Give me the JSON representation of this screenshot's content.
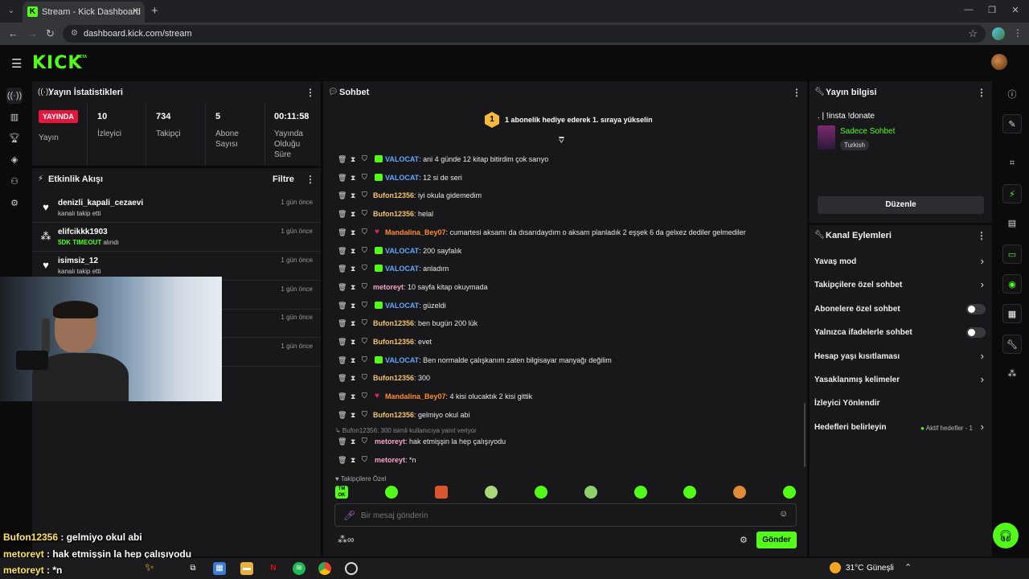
{
  "browser": {
    "tab_title": "Stream - Kick Dashboard",
    "url": "dashboard.kick.com/stream"
  },
  "header": {
    "logo": "KICK",
    "beta": "BETA"
  },
  "stats": {
    "title": "Yayın İstatistikleri",
    "live_badge": "YAYINDA",
    "live_label": "Yayın",
    "cols": [
      {
        "value": "10",
        "label": "İzleyici"
      },
      {
        "value": "734",
        "label": "Takipçi"
      },
      {
        "value": "5",
        "label": "Abone Sayısı"
      },
      {
        "value": "00:11:58",
        "label": "Yayında Olduğu Süre"
      }
    ]
  },
  "activity": {
    "title": "Etkinlik Akışı",
    "filter": "Filtre",
    "items": [
      {
        "name": "denizli_kapali_cezaevi",
        "sub": "kanalı takip etti",
        "highlight": "",
        "time": "1 gün önce",
        "icon": "heart-icon"
      },
      {
        "name": "elifcikkk1903",
        "sub": " alındı",
        "highlight": "5DK TIMEOUT",
        "time": "1 gün önce",
        "icon": "timeout-icon"
      },
      {
        "name": "isimsiz_12",
        "sub": "kanalı takip etti",
        "highlight": "",
        "time": "1 gün önce",
        "icon": "heart-icon"
      },
      {
        "time": "1 gün önce"
      },
      {
        "time": "1 gün önce"
      },
      {
        "time": "1 gün önce"
      }
    ]
  },
  "chat": {
    "title": "Sohbet",
    "gift_banner": "1 abonelik hediye ederek 1. sıraya yükselin",
    "gift_rank": "1",
    "messages": [
      {
        "user": "VALOCAT",
        "color": "#62a9ff",
        "sub": true,
        "text": ": ani 4 günde 12 kitap bitirdim çok sarıyo"
      },
      {
        "user": "VALOCAT",
        "color": "#62a9ff",
        "sub": true,
        "text": ": 12 si de seri"
      },
      {
        "user": "Bufon12356",
        "color": "#f5c46b",
        "sub": false,
        "text": ": iyi okula gidemedim"
      },
      {
        "user": "Bufon12356",
        "color": "#f5c46b",
        "sub": false,
        "text": ": helal"
      },
      {
        "user": "Mandalina_Bey07",
        "color": "#ff8c2a",
        "sub": false,
        "heart": true,
        "text": ": cumartesi aksamı da dısarıdaydım o aksam planladık 2 eşşek 6 da gelxez dediler gelmediler"
      },
      {
        "user": "VALOCAT",
        "color": "#62a9ff",
        "sub": true,
        "text": ": 200 sayfalık"
      },
      {
        "user": "VALOCAT",
        "color": "#62a9ff",
        "sub": true,
        "text": ": anladım"
      },
      {
        "user": "metoreyt",
        "color": "#f7a4c4",
        "sub": false,
        "text": ": 10 sayfa kitap okuymada"
      },
      {
        "user": "VALOCAT",
        "color": "#62a9ff",
        "sub": true,
        "text": ": güzeldi"
      },
      {
        "user": "Bufon12356",
        "color": "#f5c46b",
        "sub": false,
        "text": ": ben bugün 200 lük"
      },
      {
        "user": "Bufon12356",
        "color": "#f5c46b",
        "sub": false,
        "text": ": evet"
      },
      {
        "user": "VALOCAT",
        "color": "#62a9ff",
        "sub": true,
        "text": ": Ben normalde çalışkanım zaten bilgisayar manyağı değilim"
      },
      {
        "user": "Bufon12356",
        "color": "#f5c46b",
        "sub": false,
        "text": ": 300"
      },
      {
        "user": "Mandalina_Bey07",
        "color": "#ff8c2a",
        "sub": false,
        "heart": true,
        "text": ": 4 kisi olucaktık 2 kisi gittik"
      },
      {
        "user": "Bufon12356",
        "color": "#f5c46b",
        "sub": false,
        "text": ": gelmiyo okul abi"
      }
    ],
    "reply_note": "↳ Bufon12356: 300 isimli kullanıcıya yanıt veriyor",
    "reply_messages": [
      {
        "user": "metoreyt",
        "color": "#f7a4c4",
        "text": ": hak etmişşin la hep çalışıyodu"
      },
      {
        "user": "metoreyt",
        "color": "#f7a4c4",
        "text": ": *n"
      }
    ],
    "followers_only": "Takipçilere Özel",
    "emote_first": "TM OK",
    "input_placeholder": "Bir mesaj gönderin",
    "send": "Gönder",
    "points": "∞"
  },
  "stream_info": {
    "title": "Yayın bilgisi",
    "stream_title": ". | !insta !donate",
    "category": "Sadece Sohbet",
    "language": "Turkish",
    "edit": "Düzenle"
  },
  "channel_actions": {
    "title": "Kanal Eylemleri",
    "items": [
      {
        "label": "Yavaş mod",
        "control": "chevron"
      },
      {
        "label": "Takipçilere özel sohbet",
        "control": "chevron"
      },
      {
        "label": "Abonelere özel sohbet",
        "control": "toggle"
      },
      {
        "label": "Yalnızca ifadelerle sohbet",
        "control": "toggle"
      },
      {
        "label": "Hesap yaşı kısıtlaması",
        "control": "chevron"
      },
      {
        "label": "Yasaklanmış kelimeler",
        "control": "chevron"
      },
      {
        "label": "İzleyici Yönlendir",
        "control": "none"
      },
      {
        "label": "Hedefleri belirleyin",
        "control": "chevron",
        "badge": "Aktif hedefler - 1"
      }
    ]
  },
  "overlay": [
    {
      "name": "Bufon12356",
      "text": " : gelmiyo okul abi"
    },
    {
      "name": "metoreyt",
      "text": " : hak etmişşin la hep çalışıyodu"
    },
    {
      "name": "metoreyt",
      "text": " : *n"
    }
  ],
  "taskbar": {
    "weather": "31°C",
    "weather_label": "Güneşli"
  },
  "colors": {
    "accent": "#53fc18",
    "live": "#e3173d",
    "panel": "#18181b"
  }
}
